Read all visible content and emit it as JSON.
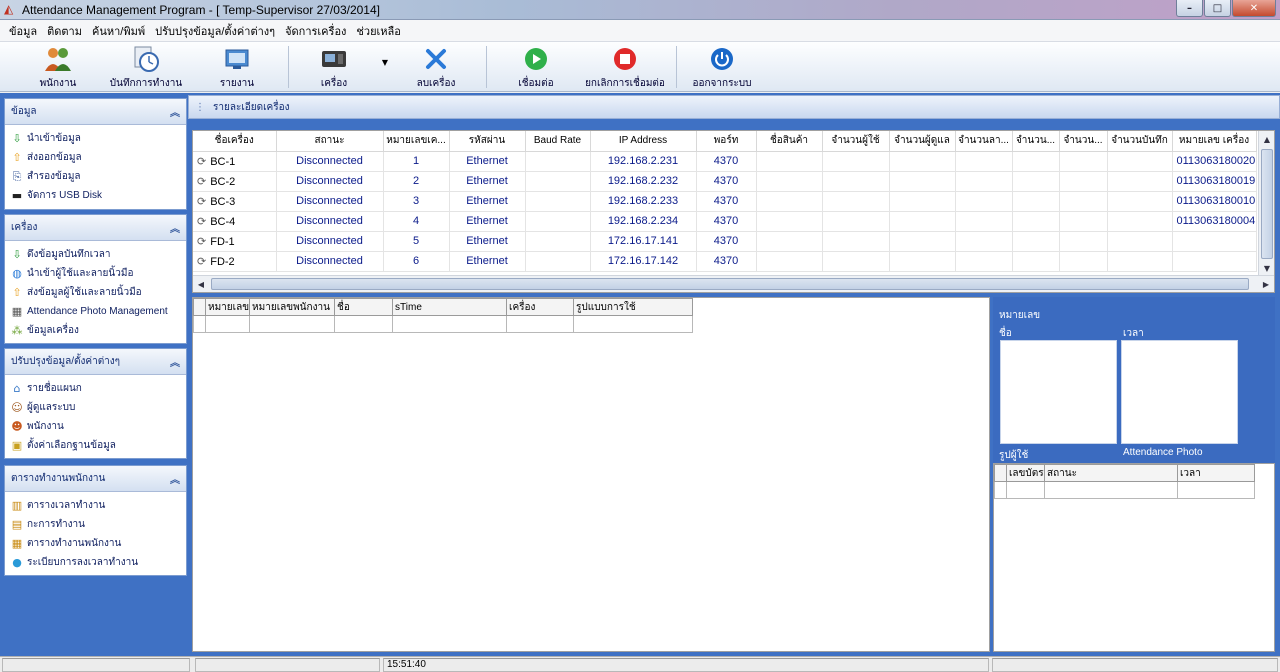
{
  "window": {
    "title": "Attendance Management Program - [ Temp-Supervisor 27/03/2014]",
    "min": "–",
    "max": "□",
    "close": "✕"
  },
  "menu": [
    "ข้อมูล",
    "ติดตาม",
    "ค้นหา/พิมพ์",
    "ปรับปรุงข้อมูล/ตั้งค่าต่างๆ",
    "จัดการเครื่อง",
    "ช่วยเหลือ"
  ],
  "toolbar": {
    "employee": "พนักงาน",
    "attendance_log": "บันทึกการทำงาน",
    "report": "รายงาน",
    "device": "เครื่อง",
    "delete_device": "ลบเครื่อง",
    "connect": "เชื่อมต่อ",
    "disconnect": "ยกเลิกการเชื่อมต่อ",
    "logout": "ออกจากระบบ"
  },
  "sidebar": {
    "data": {
      "title": "ข้อมูล",
      "items": [
        "นำเข้าข้อมูล",
        "ส่งออกข้อมูล",
        "สำรองข้อมูล",
        "จัดการ USB Disk"
      ]
    },
    "device": {
      "title": "เครื่อง",
      "items": [
        "ดึงข้อมูลบันทึกเวลา",
        "นำเข้าผู้ใช้และลายนิ้วมือ",
        "ส่งข้อมูลผู้ใช้และลายนิ้วมือ",
        "Attendance Photo Management",
        "ข้อมูลเครื่อง"
      ]
    },
    "settings": {
      "title": "ปรับปรุงข้อมูล/ตั้งค่าต่างๆ",
      "items": [
        "รายชื่อแผนก",
        "ผู้ดูแลระบบ",
        "พนักงาน",
        "ตั้งค่าเลือกฐานข้อมูล"
      ]
    },
    "schedule": {
      "title": "ตารางทำงานพนักงาน",
      "items": [
        "ตารางเวลาทำงาน",
        "กะการทำงาน",
        "ตารางทำงานพนักงาน",
        "ระเบียบการลงเวลาทำงาน"
      ]
    }
  },
  "detail_header": "รายละเอียดเครื่อง",
  "device_table": {
    "columns": [
      "ชื่อเครื่อง",
      "สถานะ",
      "หมายเลขเค...",
      "รหัสผ่าน",
      "Baud Rate",
      "IP Address",
      "พอร์ท",
      "ชื่อสินค้า",
      "จำนวนผู้ใช้",
      "จำนวนผู้ดูแล",
      "จำนวนลา...",
      "จำนวน...",
      "จำนวน...",
      "จำนวนบันทึก",
      "หมายเลข เครื่อง"
    ],
    "rows": [
      {
        "name": "BC-1",
        "status": "Disconnected",
        "num": "1",
        "comm": "Ethernet",
        "ip": "192.168.2.231",
        "port": "4370",
        "serial": "0113063180020"
      },
      {
        "name": "BC-2",
        "status": "Disconnected",
        "num": "2",
        "comm": "Ethernet",
        "ip": "192.168.2.232",
        "port": "4370",
        "serial": "0113063180019"
      },
      {
        "name": "BC-3",
        "status": "Disconnected",
        "num": "3",
        "comm": "Ethernet",
        "ip": "192.168.2.233",
        "port": "4370",
        "serial": "0113063180010"
      },
      {
        "name": "BC-4",
        "status": "Disconnected",
        "num": "4",
        "comm": "Ethernet",
        "ip": "192.168.2.234",
        "port": "4370",
        "serial": "0113063180004"
      },
      {
        "name": "FD-1",
        "status": "Disconnected",
        "num": "5",
        "comm": "Ethernet",
        "ip": "172.16.17.141",
        "port": "4370",
        "serial": ""
      },
      {
        "name": "FD-2",
        "status": "Disconnected",
        "num": "6",
        "comm": "Ethernet",
        "ip": "172.16.17.142",
        "port": "4370",
        "serial": ""
      }
    ]
  },
  "log_table": {
    "columns": [
      "หมายเลข",
      "หมายเลขพนักงาน",
      "ชื่อ",
      "sTime",
      "เครื่อง",
      "รูปแบบการใช้"
    ]
  },
  "photo_panel": {
    "number": "หมายเลข",
    "name": "ชื่อ",
    "time": "เวลา",
    "user_photo": "รูปผู้ใช้",
    "attendance_photo": "Attendance Photo"
  },
  "attendance_table": {
    "columns": [
      "เลขบัตร",
      "สถานะ",
      "เวลา"
    ]
  },
  "status": {
    "time": "15:51:40"
  },
  "colors": {
    "panel_blue": "#3f71c4",
    "status_text": "#0a1a8a"
  }
}
